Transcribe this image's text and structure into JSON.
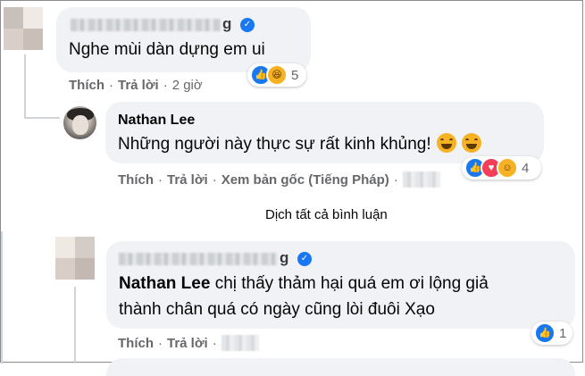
{
  "comments": [
    {
      "name_tail": "g",
      "text": "Nghe mùi dàn dựng em ui",
      "actions": {
        "like": "Thích",
        "reply": "Trả lời",
        "time": "2 giờ"
      },
      "reactions": {
        "icons": [
          "like-icon",
          "haha-icon"
        ],
        "count": "5"
      }
    },
    {
      "name": "Nathan Lee",
      "text": "Những người này thực sự rất kinh khủng!",
      "emojis": [
        "laughing-tears-emoji",
        "laughing-tears-emoji"
      ],
      "actions": {
        "like": "Thích",
        "reply": "Trả lời",
        "view_original": "Xem bản gốc (Tiếng Pháp)"
      },
      "reactions": {
        "icons": [
          "like-icon",
          "love-icon",
          "care-icon"
        ],
        "count": "4"
      }
    },
    {
      "name_tail": "g",
      "mention": "Nathan Lee",
      "text": " chị thấy thảm hại quá em ơi lộng giả thành chân quá có ngày cũng lòi đuôi Xạo",
      "actions": {
        "like": "Thích",
        "reply": "Trả lời"
      },
      "reactions": {
        "icons": [
          "like-icon"
        ],
        "count": "1"
      }
    }
  ],
  "translate_all": "Dịch tất cả bình luận",
  "colors": {
    "accent": "#1877f2",
    "bubble": "#f0f2f5",
    "meta": "#65676b"
  }
}
